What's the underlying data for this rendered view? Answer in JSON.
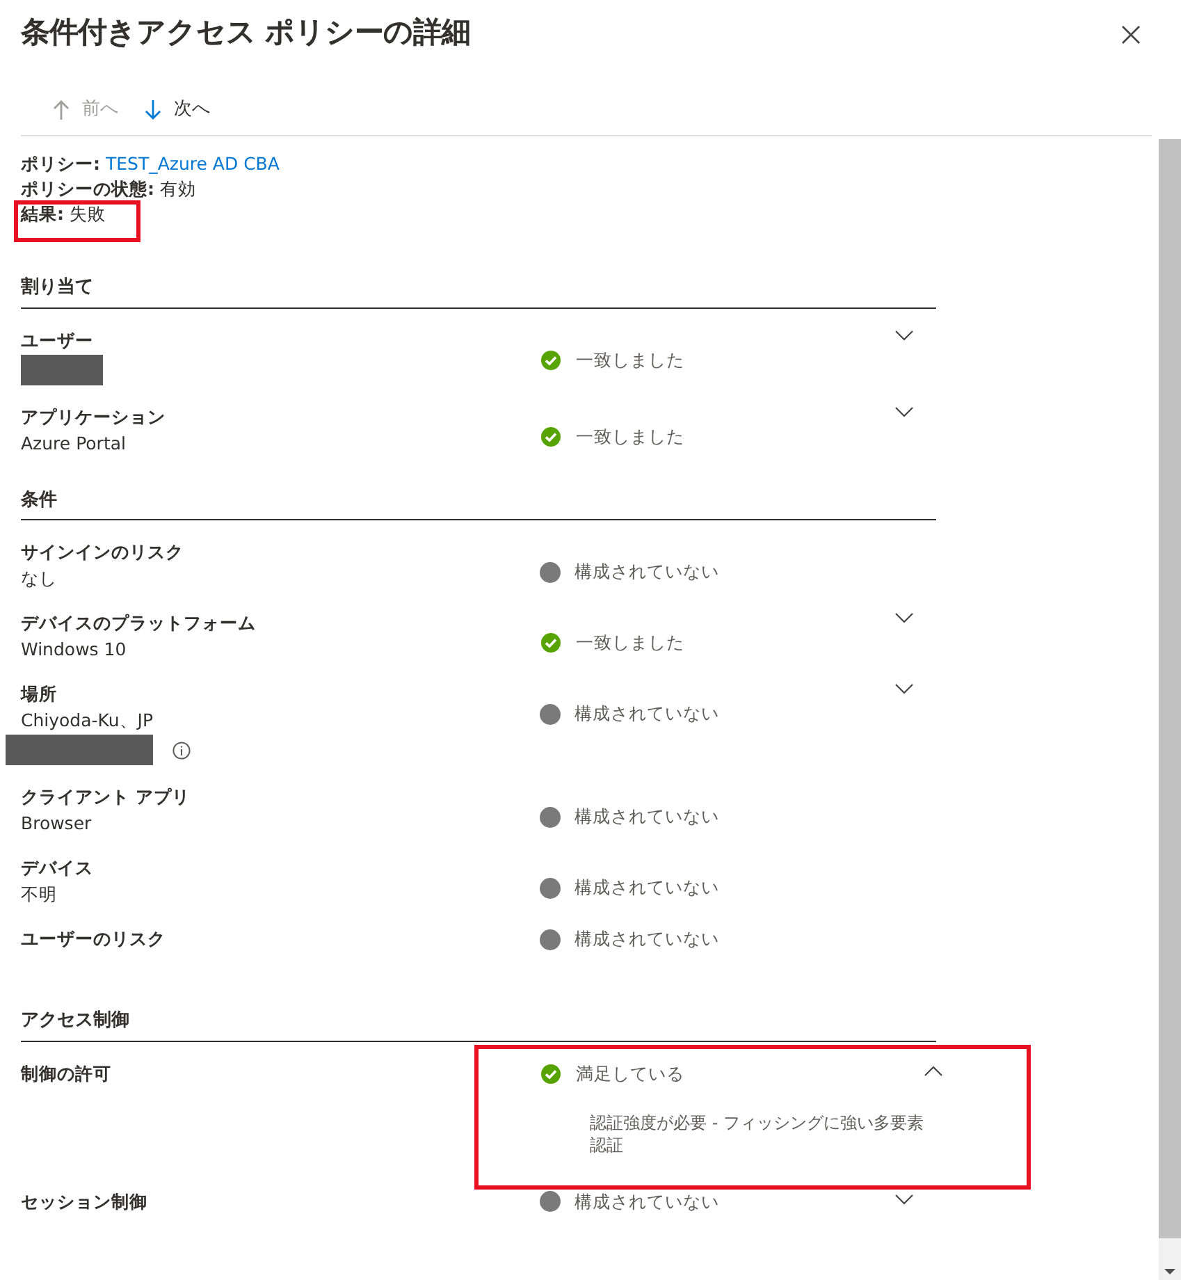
{
  "title": "条件付きアクセス ポリシーの詳細",
  "nav": [
    {
      "label": "前へ",
      "kind": "up",
      "disabled": true
    },
    {
      "label": "次へ",
      "kind": "down",
      "disabled": false
    }
  ],
  "policy_info": [
    {
      "label": "ポリシー:",
      "value": "TEST_Azure AD CBA",
      "link": true,
      "highlighted": false
    },
    {
      "label": "ポリシーの状態:",
      "value": "有効",
      "link": false,
      "highlighted": false
    },
    {
      "label": "結果:",
      "value": "失敗",
      "link": false,
      "highlighted": true
    }
  ],
  "sections": [
    {
      "title": "割り当て",
      "rows": [
        {
          "label": "ユーザー",
          "redacted": true,
          "info": false,
          "kind": "matched",
          "status_text": "一致しました",
          "expandable": true,
          "expanded": false,
          "highlighted": false
        },
        {
          "label": "アプリケーション",
          "value": "Azure Portal",
          "redacted": false,
          "info": false,
          "kind": "matched",
          "status_text": "一致しました",
          "expandable": true,
          "expanded": false,
          "highlighted": false
        }
      ]
    },
    {
      "title": "条件",
      "rows": [
        {
          "label": "サインインのリスク",
          "value": "なし",
          "redacted": false,
          "info": false,
          "kind": "not_configured",
          "status_text": "構成されていない",
          "expandable": false,
          "expanded": false,
          "highlighted": false
        },
        {
          "label": "デバイスのプラットフォーム",
          "value": "Windows 10",
          "redacted": false,
          "info": false,
          "kind": "matched",
          "status_text": "一致しました",
          "expandable": true,
          "expanded": false,
          "highlighted": false
        },
        {
          "label": "場所",
          "value": "Chiyoda-Ku、JP",
          "redacted": true,
          "info": true,
          "kind": "not_configured",
          "status_text": "構成されていない",
          "expandable": true,
          "expanded": false,
          "highlighted": false
        },
        {
          "label": "クライアント アプリ",
          "value": "Browser",
          "redacted": false,
          "info": false,
          "kind": "not_configured",
          "status_text": "構成されていない",
          "expandable": false,
          "expanded": false,
          "highlighted": false
        },
        {
          "label": "デバイス",
          "value": "不明",
          "redacted": false,
          "info": false,
          "kind": "not_configured",
          "status_text": "構成されていない",
          "expandable": false,
          "expanded": false,
          "highlighted": false
        },
        {
          "label": "ユーザーのリスク",
          "redacted": false,
          "info": false,
          "kind": "not_configured",
          "status_text": "構成されていない",
          "expandable": false,
          "expanded": false,
          "highlighted": false
        }
      ]
    },
    {
      "title": "アクセス制御",
      "rows": [
        {
          "label": "制御の許可",
          "redacted": false,
          "info": false,
          "kind": "matched",
          "status_text": "満足している",
          "expandable": true,
          "expanded": true,
          "detail": "認証強度が必要 - フィッシングに強い多要素認証",
          "highlighted": true
        },
        {
          "label": "セッション制御",
          "redacted": false,
          "info": false,
          "kind": "not_configured",
          "status_text": "構成されていない",
          "expandable": true,
          "expanded": false,
          "highlighted": false
        }
      ]
    }
  ]
}
